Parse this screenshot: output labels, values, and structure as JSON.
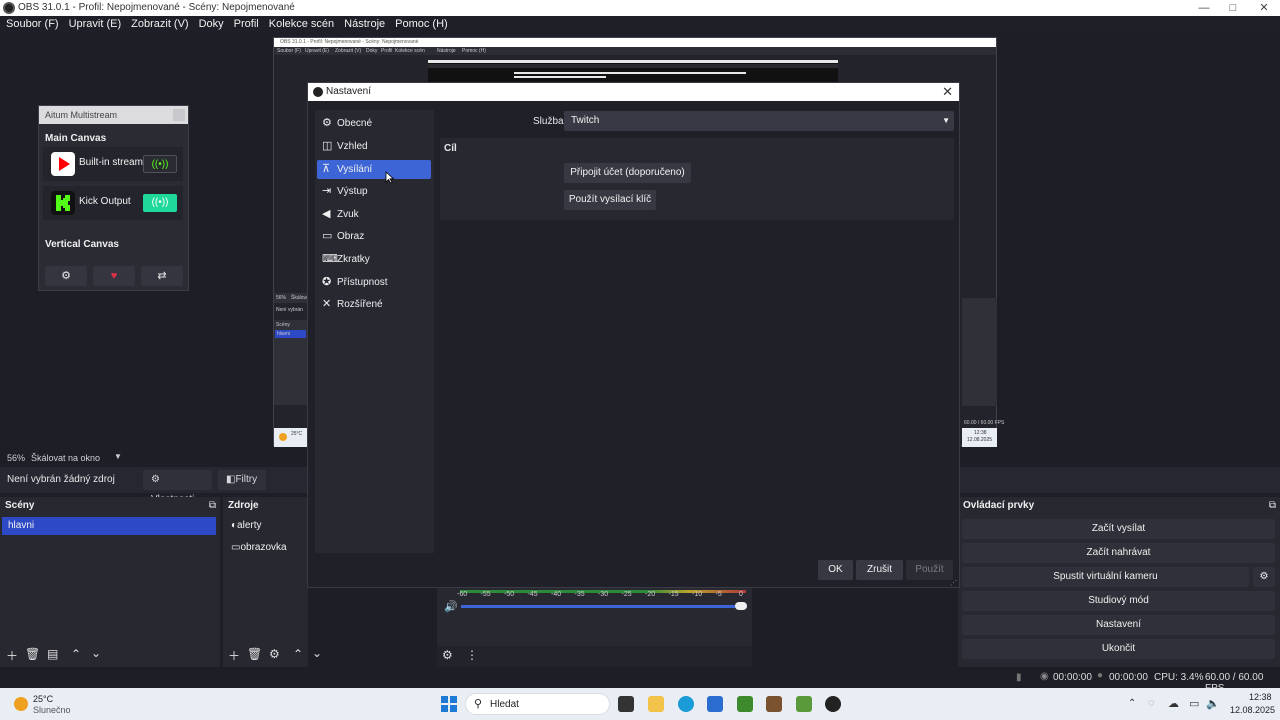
{
  "window": {
    "title": "OBS 31.0.1 - Profil: Nepojmenované - Scény: Nepojmenované",
    "minimize": "—",
    "maximize": "□",
    "close": "✕"
  },
  "menu": [
    "Soubor (F)",
    "Upravit (E)",
    "Zobrazit (V)",
    "Doky",
    "Profil",
    "Kolekce scén",
    "Nástroje",
    "Pomoc (H)"
  ],
  "preview": {
    "inner_title": "OBS 31.0.1 - Profil: Nepojmenované - Scény: Nepojmenované",
    "inner_menu": [
      "Soubor (F)",
      "Upravit (E)",
      "Zobrazit (V)",
      "Doky",
      "Profil",
      "Kolekce scén",
      "Nástroje",
      "Pomoc (H)"
    ],
    "inner_zoom": "56%",
    "inner_scale": "Škálovat",
    "inner_no_source": "Není vybrán",
    "inner_scenes": "Scény",
    "inner_scene": "hlavni",
    "inner_fps": "60.00 / 60.00 FPS",
    "inner_weather": "25°C",
    "inner_time": "12:38",
    "inner_date": "12.08.2025"
  },
  "aitum": {
    "title": "Aitum Multistream",
    "main_canvas": "Main Canvas",
    "outputs": [
      {
        "name": "Built-in stream",
        "icon": "youtube-play-icon",
        "brand": "#ff0000",
        "state": "off"
      },
      {
        "name": "Kick Output",
        "icon": "kick-icon",
        "brand": "#53fc18",
        "state": "on"
      }
    ],
    "stream_glyph": "((•))",
    "vertical_canvas": "Vertical Canvas",
    "bottom_buttons": [
      "gear-icon",
      "heart-icon",
      "share-icon"
    ]
  },
  "status_row": {
    "zoom": "56%",
    "scale": "Škálovat na okno"
  },
  "source_toolbar": {
    "no_source": "Není vybrán žádný zdroj",
    "properties": "Vlastnosti",
    "filters": "Filtry"
  },
  "scenes": {
    "title": "Scény",
    "items": [
      "hlavni"
    ]
  },
  "sources": {
    "title": "Zdroje",
    "items": [
      {
        "name": "alerty",
        "icon": "browser-icon"
      },
      {
        "name": "obrazovka",
        "icon": "display-icon"
      }
    ]
  },
  "mixer": {
    "ticks": [
      "-60",
      "-55",
      "-50",
      "-45",
      "-40",
      "-35",
      "-30",
      "-25",
      "-20",
      "-15",
      "-10",
      "-5",
      "0"
    ],
    "level": 1.0
  },
  "controls": {
    "title": "Ovládací prvky",
    "buttons": [
      "Začít vysílat",
      "Začít nahrávat",
      "Spustit virtuální kameru",
      "Studiový mód",
      "Nastavení",
      "Ukončit"
    ]
  },
  "statusbar": {
    "stream_time": "00:00:00",
    "rec_time": "00:00:00",
    "cpu": "CPU: 3.4%",
    "fps": "60.00 / 60.00 FPS"
  },
  "taskbar": {
    "temp": "25°C",
    "weather": "Slunečno",
    "search": "Hledat",
    "time": "12:38",
    "date": "12.08.2025"
  },
  "dialog": {
    "title": "Nastavení",
    "close": "✕",
    "sidebar": [
      {
        "label": "Obecné",
        "icon": "gear-icon"
      },
      {
        "label": "Vzhled",
        "icon": "appearance-icon"
      },
      {
        "label": "Vysílání",
        "icon": "antenna-icon",
        "active": true
      },
      {
        "label": "Výstup",
        "icon": "output-icon"
      },
      {
        "label": "Zvuk",
        "icon": "speaker-icon"
      },
      {
        "label": "Obraz",
        "icon": "monitor-icon"
      },
      {
        "label": "Zkratky",
        "icon": "keyboard-icon"
      },
      {
        "label": "Přístupnost",
        "icon": "accessibility-icon"
      },
      {
        "label": "Rozšířené",
        "icon": "wrench-icon"
      }
    ],
    "service_label": "Služba",
    "service_value": "Twitch",
    "destination_label": "Cíl",
    "connect_account": "Připojit účet (doporučeno)",
    "use_stream_key": "Použít vysílací klíč",
    "ok": "OK",
    "cancel": "Zrušit",
    "apply": "Použít"
  }
}
